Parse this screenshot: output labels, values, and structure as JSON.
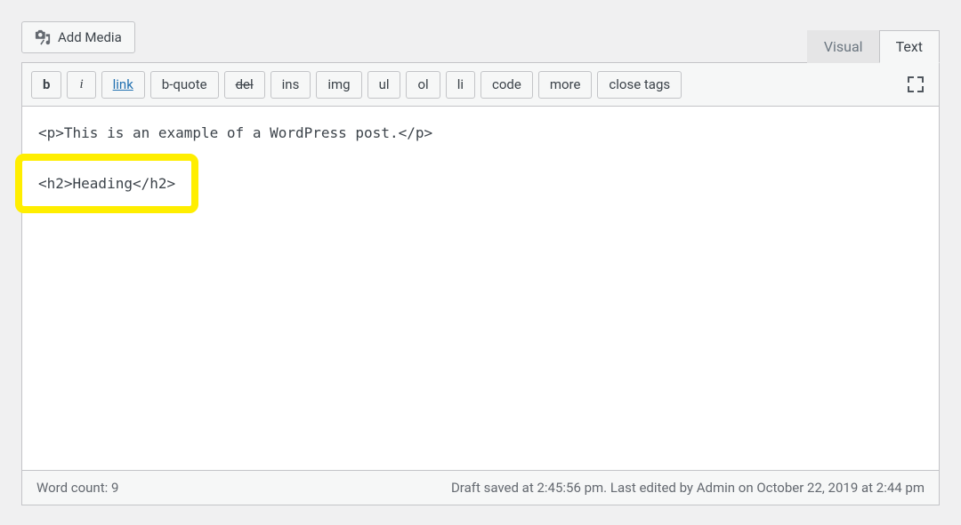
{
  "add_media_label": "Add Media",
  "tabs": {
    "visual": "Visual",
    "text": "Text"
  },
  "quicktags": {
    "bold": "b",
    "italic": "i",
    "link": "link",
    "bquote": "b-quote",
    "del": "del",
    "ins": "ins",
    "img": "img",
    "ul": "ul",
    "ol": "ol",
    "li": "li",
    "code": "code",
    "more": "more",
    "close": "close tags"
  },
  "content": {
    "line1": "<p>This is an example of a WordPress post.</p>",
    "line2": "<h2>Heading</h2>"
  },
  "status": {
    "word_count_label": "Word count: 9",
    "save_status": "Draft saved at 2:45:56 pm. Last edited by Admin on October 22, 2019 at 2:44 pm"
  }
}
